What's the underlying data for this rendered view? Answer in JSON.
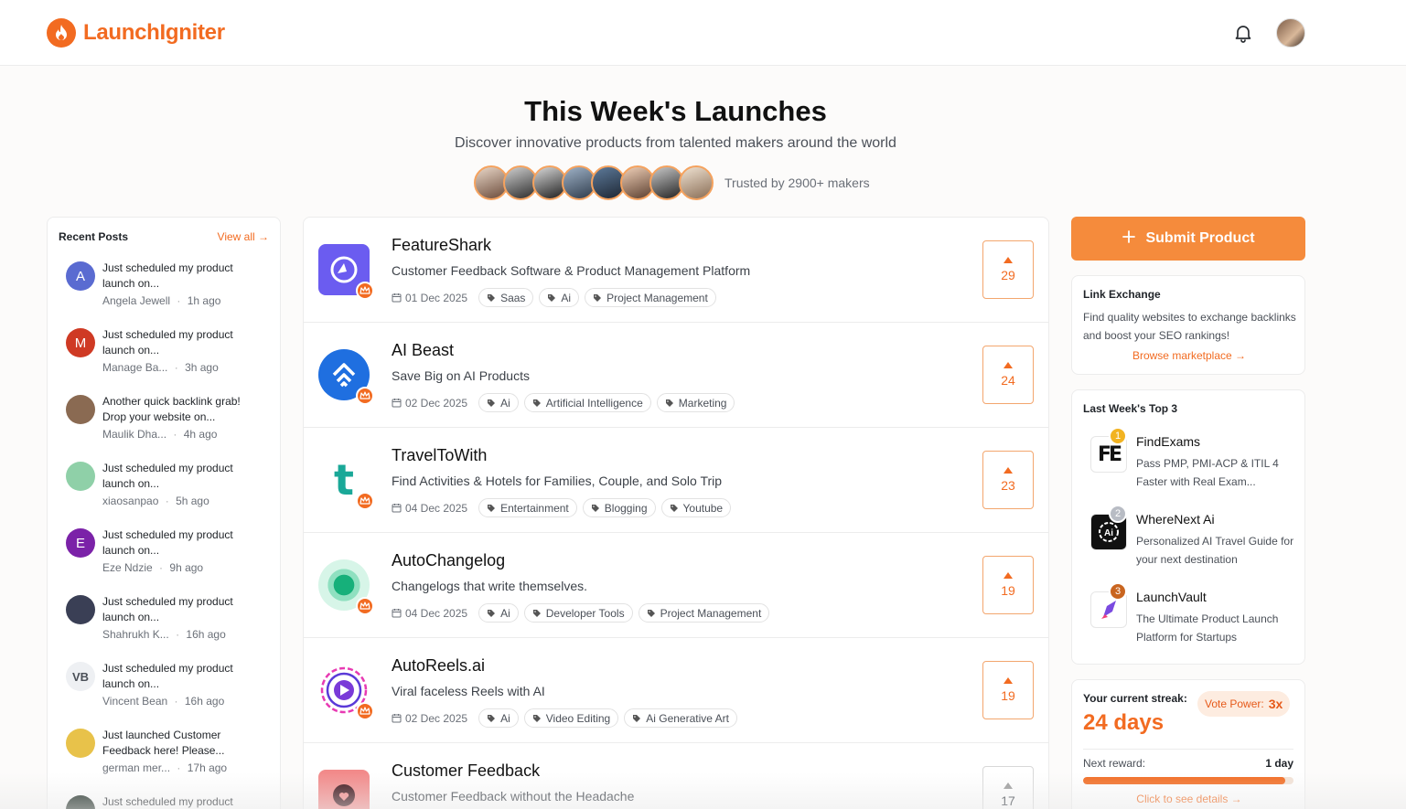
{
  "brand": {
    "name": "LaunchIgniter",
    "color": "#f26b21"
  },
  "header": {
    "notification_icon": "bell-icon",
    "avatar_icon": "user-avatar"
  },
  "hero": {
    "title": "This Week's Launches",
    "subtitle": "Discover innovative products from talented makers around the world",
    "trusted": "Trusted by 2900+ makers",
    "maker_count_shown": 8
  },
  "recent_posts": {
    "title": "Recent Posts",
    "view_all": "View all →",
    "items": [
      {
        "initial": "A",
        "color": "#5a6bd1",
        "text": "Just scheduled my product launch on...",
        "author": "Angela Jewell",
        "time": "1h ago"
      },
      {
        "initial": "M",
        "color": "#cf3a24",
        "text": "Just scheduled my product launch on...",
        "author": "Manage Ba...",
        "time": "3h ago"
      },
      {
        "initial": "",
        "color": "#8a6a52",
        "text": "Another quick backlink grab! Drop your website on...",
        "author": "Maulik Dha...",
        "time": "4h ago"
      },
      {
        "initial": "",
        "color": "#8fd0a8",
        "text": "Just scheduled my product launch on...",
        "author": "xiaosanpao",
        "time": "5h ago"
      },
      {
        "initial": "E",
        "color": "#7b22a8",
        "text": "Just scheduled my product launch on...",
        "author": "Eze Ndzie",
        "time": "9h ago"
      },
      {
        "initial": "",
        "color": "#3a3f55",
        "text": "Just scheduled my product launch on...",
        "author": "Shahrukh K...",
        "time": "16h ago"
      },
      {
        "initial": "VB",
        "color": "#eef0f3",
        "text": "Just scheduled my product launch on...",
        "author": "Vincent Bean",
        "time": "16h ago"
      },
      {
        "initial": "",
        "color": "#e8c24a",
        "text": "Just launched Customer Feedback here! Please...",
        "author": "german mer...",
        "time": "17h ago"
      },
      {
        "initial": "",
        "color": "#1c2a22",
        "text": "Just scheduled my product",
        "author": "",
        "time": ""
      }
    ]
  },
  "products": [
    {
      "name": "FeatureShark",
      "desc": "Customer Feedback Software & Product Management Platform",
      "date": "01 Dec 2025",
      "tags": [
        "Saas",
        "Ai",
        "Project Management"
      ],
      "votes": "29",
      "logo_color": "#6b5cf0"
    },
    {
      "name": "AI Beast",
      "desc": "Save Big on AI Products",
      "date": "02 Dec 2025",
      "tags": [
        "Ai",
        "Artificial Intelligence",
        "Marketing"
      ],
      "votes": "24",
      "logo_color": "#1f6fe0"
    },
    {
      "name": "TravelToWith",
      "desc": "Find Activities & Hotels for Families, Couple, and Solo Trip",
      "date": "04 Dec 2025",
      "tags": [
        "Entertainment",
        "Blogging",
        "Youtube"
      ],
      "votes": "23",
      "logo_color": "#1aa898"
    },
    {
      "name": "AutoChangelog",
      "desc": "Changelogs that write themselves.",
      "date": "04 Dec 2025",
      "tags": [
        "Ai",
        "Developer Tools",
        "Project Management"
      ],
      "votes": "19",
      "logo_color": "#16b07a"
    },
    {
      "name": "AutoReels.ai",
      "desc": "Viral faceless Reels with AI",
      "date": "02 Dec 2025",
      "tags": [
        "Ai",
        "Video Editing",
        "Ai Generative Art"
      ],
      "votes": "19",
      "logo_color": "#7a3ad8"
    },
    {
      "name": "Customer Feedback",
      "desc": "Customer Feedback without the Headache",
      "date": "",
      "tags": [],
      "votes": "17",
      "logo_color": "#f28a8a"
    }
  ],
  "sidebar": {
    "submit_label": "Submit Product",
    "link_exchange": {
      "title": "Link Exchange",
      "desc": "Find quality websites to exchange backlinks and boost your SEO rankings!",
      "link": "Browse marketplace →"
    },
    "top3": {
      "title": "Last Week's Top 3",
      "items": [
        {
          "rank": "1",
          "rank_color": "#f2b321",
          "name": "FindExams",
          "desc": "Pass PMP, PMI-ACP & ITIL 4 Faster with Real Exam..."
        },
        {
          "rank": "2",
          "rank_color": "#b8bcc4",
          "name": "WhereNext Ai",
          "desc": "Personalized AI Travel Guide for your next destination"
        },
        {
          "rank": "3",
          "rank_color": "#c9651f",
          "name": "LaunchVault",
          "desc": "The Ultimate Product Launch Platform for Startups"
        }
      ]
    },
    "streak": {
      "label": "Your current streak:",
      "days": "24 days",
      "vote_power_label": "Vote Power:",
      "vote_power_value": "3x",
      "next_reward_label": "Next reward:",
      "next_reward_value": "1 day",
      "progress_fraction": 0.96,
      "details_link": "Click to see details →"
    }
  }
}
